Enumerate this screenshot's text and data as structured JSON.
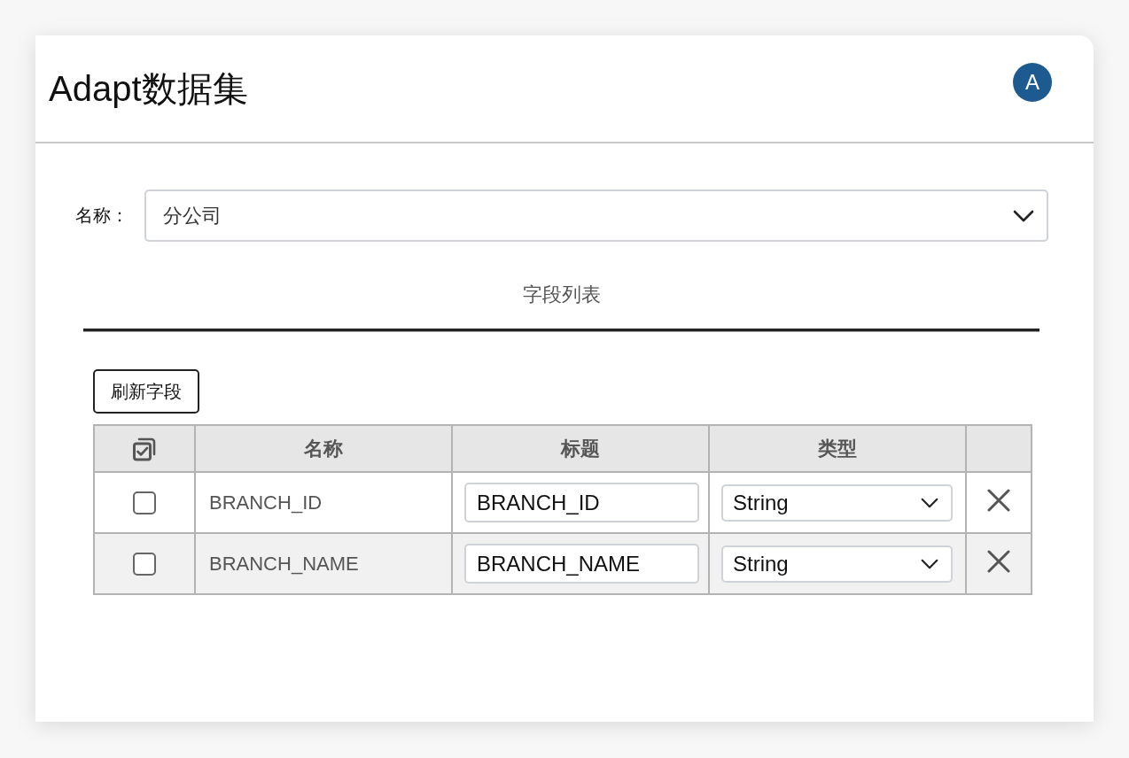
{
  "header": {
    "title": "Adapt数据集",
    "avatar": "A"
  },
  "name_field": {
    "label": "名称：",
    "value": "分公司"
  },
  "tabs": [
    {
      "label": "字段列表",
      "selected": true
    }
  ],
  "refresh_button": "刷新字段",
  "table": {
    "columns": [
      "名称",
      "标题",
      "类型"
    ],
    "rows": [
      {
        "checked": false,
        "name": "BRANCH_ID",
        "title": "BRANCH_ID",
        "type": "String"
      },
      {
        "checked": false,
        "name": "BRANCH_NAME",
        "title": "BRANCH_NAME",
        "type": "String"
      }
    ]
  }
}
